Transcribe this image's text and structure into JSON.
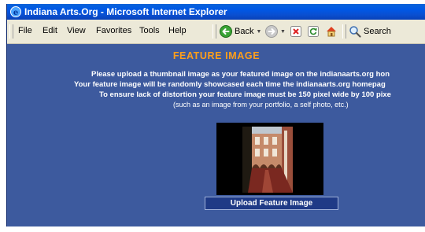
{
  "window": {
    "title": "Indiana Arts.Org - Microsoft Internet Explorer"
  },
  "menu": [
    "File",
    "Edit",
    "View",
    "Favorites",
    "Tools",
    "Help"
  ],
  "toolbar": {
    "back_label": "Back",
    "search_label": "Search"
  },
  "page": {
    "heading": "FEATURE IMAGE",
    "lines": [
      "Please upload a thumbnail image as your featured image on the indianaarts.org hon",
      "Your feature image will be randomly showcased each time the indianaarts.org homepag",
      "To ensure lack of distortion your feature image must be 150 pixel wide by 100 pixe"
    ],
    "subline": "(such as an image from your portfolio, a self photo, etc.)",
    "upload_button": "Upload Feature Image"
  },
  "colors": {
    "page_background": "#3d5a9e",
    "heading": "#ff9f1a",
    "button_background": "#1f3a86"
  }
}
